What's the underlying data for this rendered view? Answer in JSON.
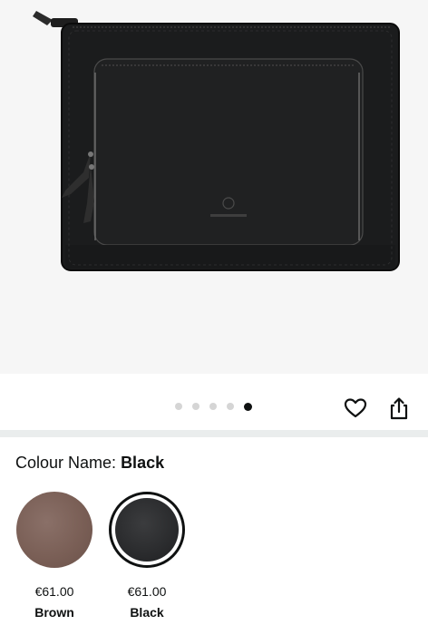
{
  "product": {
    "image_alt": "Black leather laptop sleeve with zip pocket",
    "carousel": {
      "total": 5,
      "active_index": 4
    }
  },
  "actions": {
    "wishlist_icon": "heart-icon",
    "share_icon": "share-icon"
  },
  "variation": {
    "label": "Colour Name:",
    "selected": "Black",
    "options": [
      {
        "name": "Brown",
        "price": "€61.00",
        "color": "#7a5f56"
      },
      {
        "name": "Black",
        "price": "€61.00",
        "color": "#2a2b2d"
      }
    ]
  }
}
